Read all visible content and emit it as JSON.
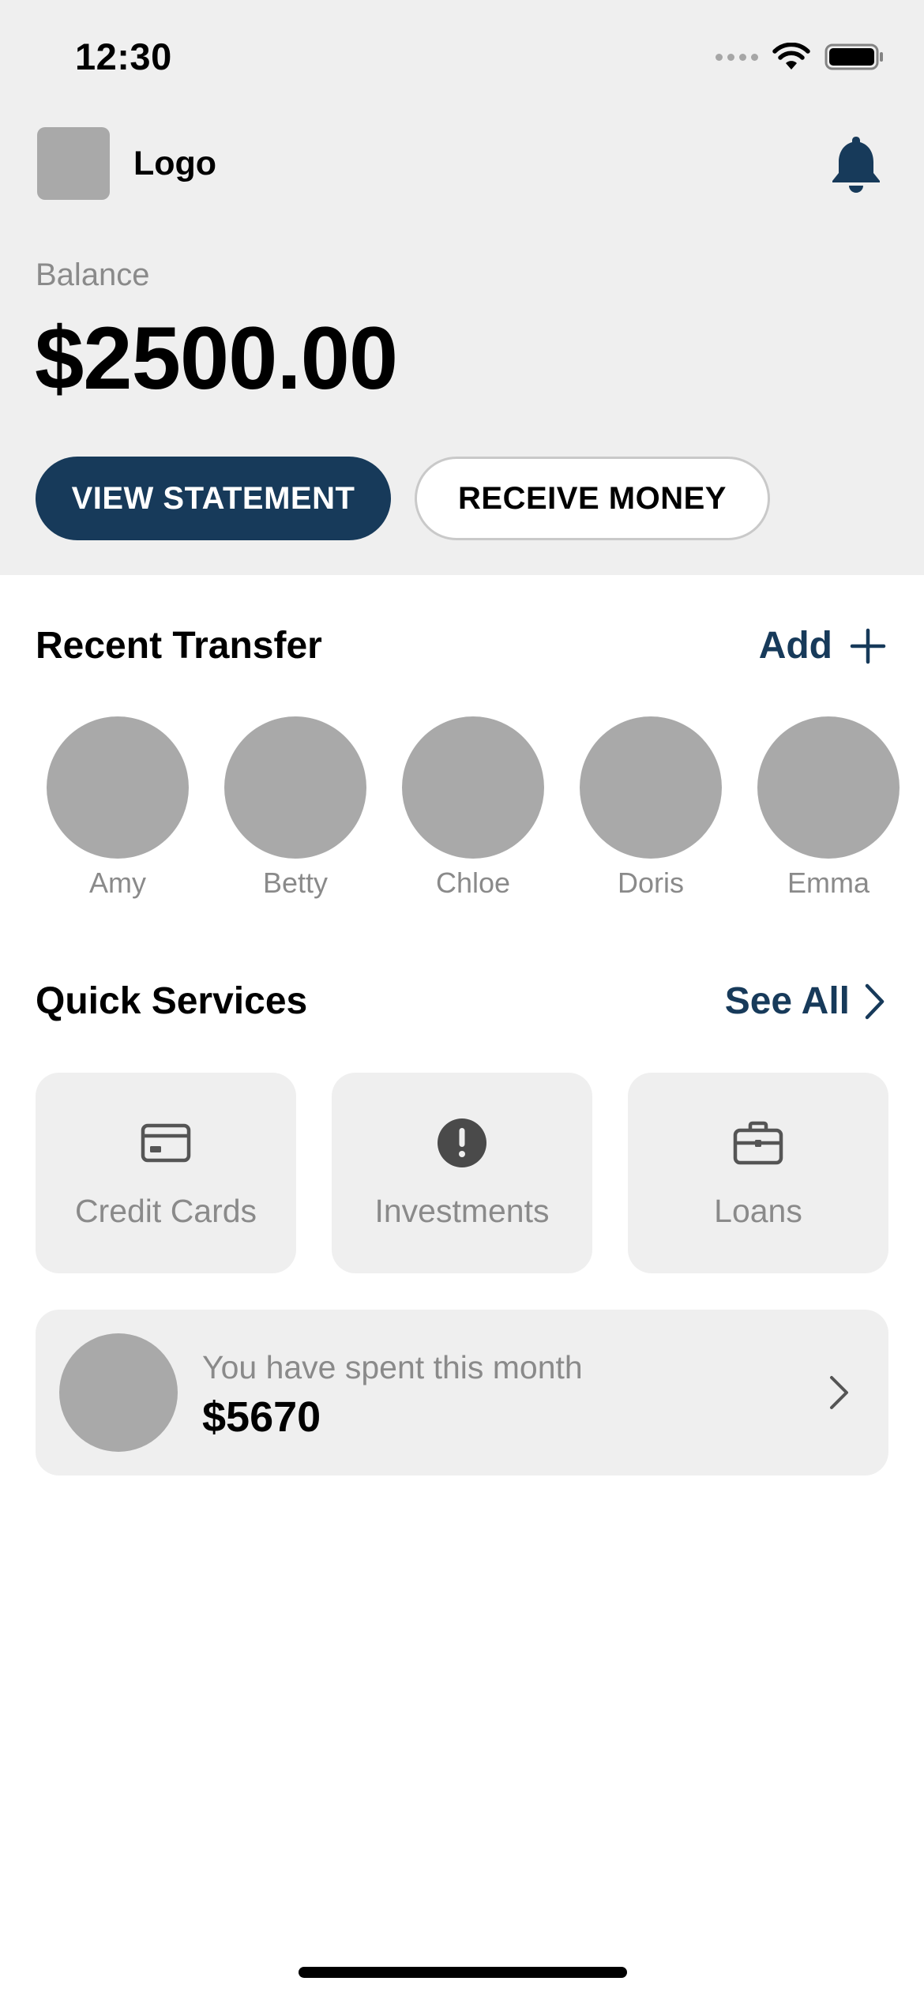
{
  "status_bar": {
    "time": "12:30"
  },
  "header": {
    "logo_label": "Logo",
    "notification_icon": "bell-icon"
  },
  "balance": {
    "label": "Balance",
    "value": "$2500.00"
  },
  "actions": {
    "view_statement": "VIEW STATEMENT",
    "receive_money": "RECEIVE MONEY"
  },
  "recent_transfer": {
    "title": "Recent Transfer",
    "add_label": "Add",
    "contacts": [
      {
        "name": "Amy"
      },
      {
        "name": "Betty"
      },
      {
        "name": "Chloe"
      },
      {
        "name": "Doris"
      },
      {
        "name": "Emma"
      }
    ]
  },
  "quick_services": {
    "title": "Quick Services",
    "see_all_label": "See All",
    "items": [
      {
        "label": "Credit Cards",
        "icon": "credit-card-icon"
      },
      {
        "label": "Investments",
        "icon": "exclamation-circle-icon"
      },
      {
        "label": "Loans",
        "icon": "briefcase-icon"
      }
    ]
  },
  "spending": {
    "label": "You have spent this month",
    "value": "$5670"
  },
  "colors": {
    "brand_navy": "#173a5a",
    "surface_grey": "#efefef",
    "placeholder_grey": "#a9a9a9",
    "muted_text": "#8a8a8a"
  }
}
